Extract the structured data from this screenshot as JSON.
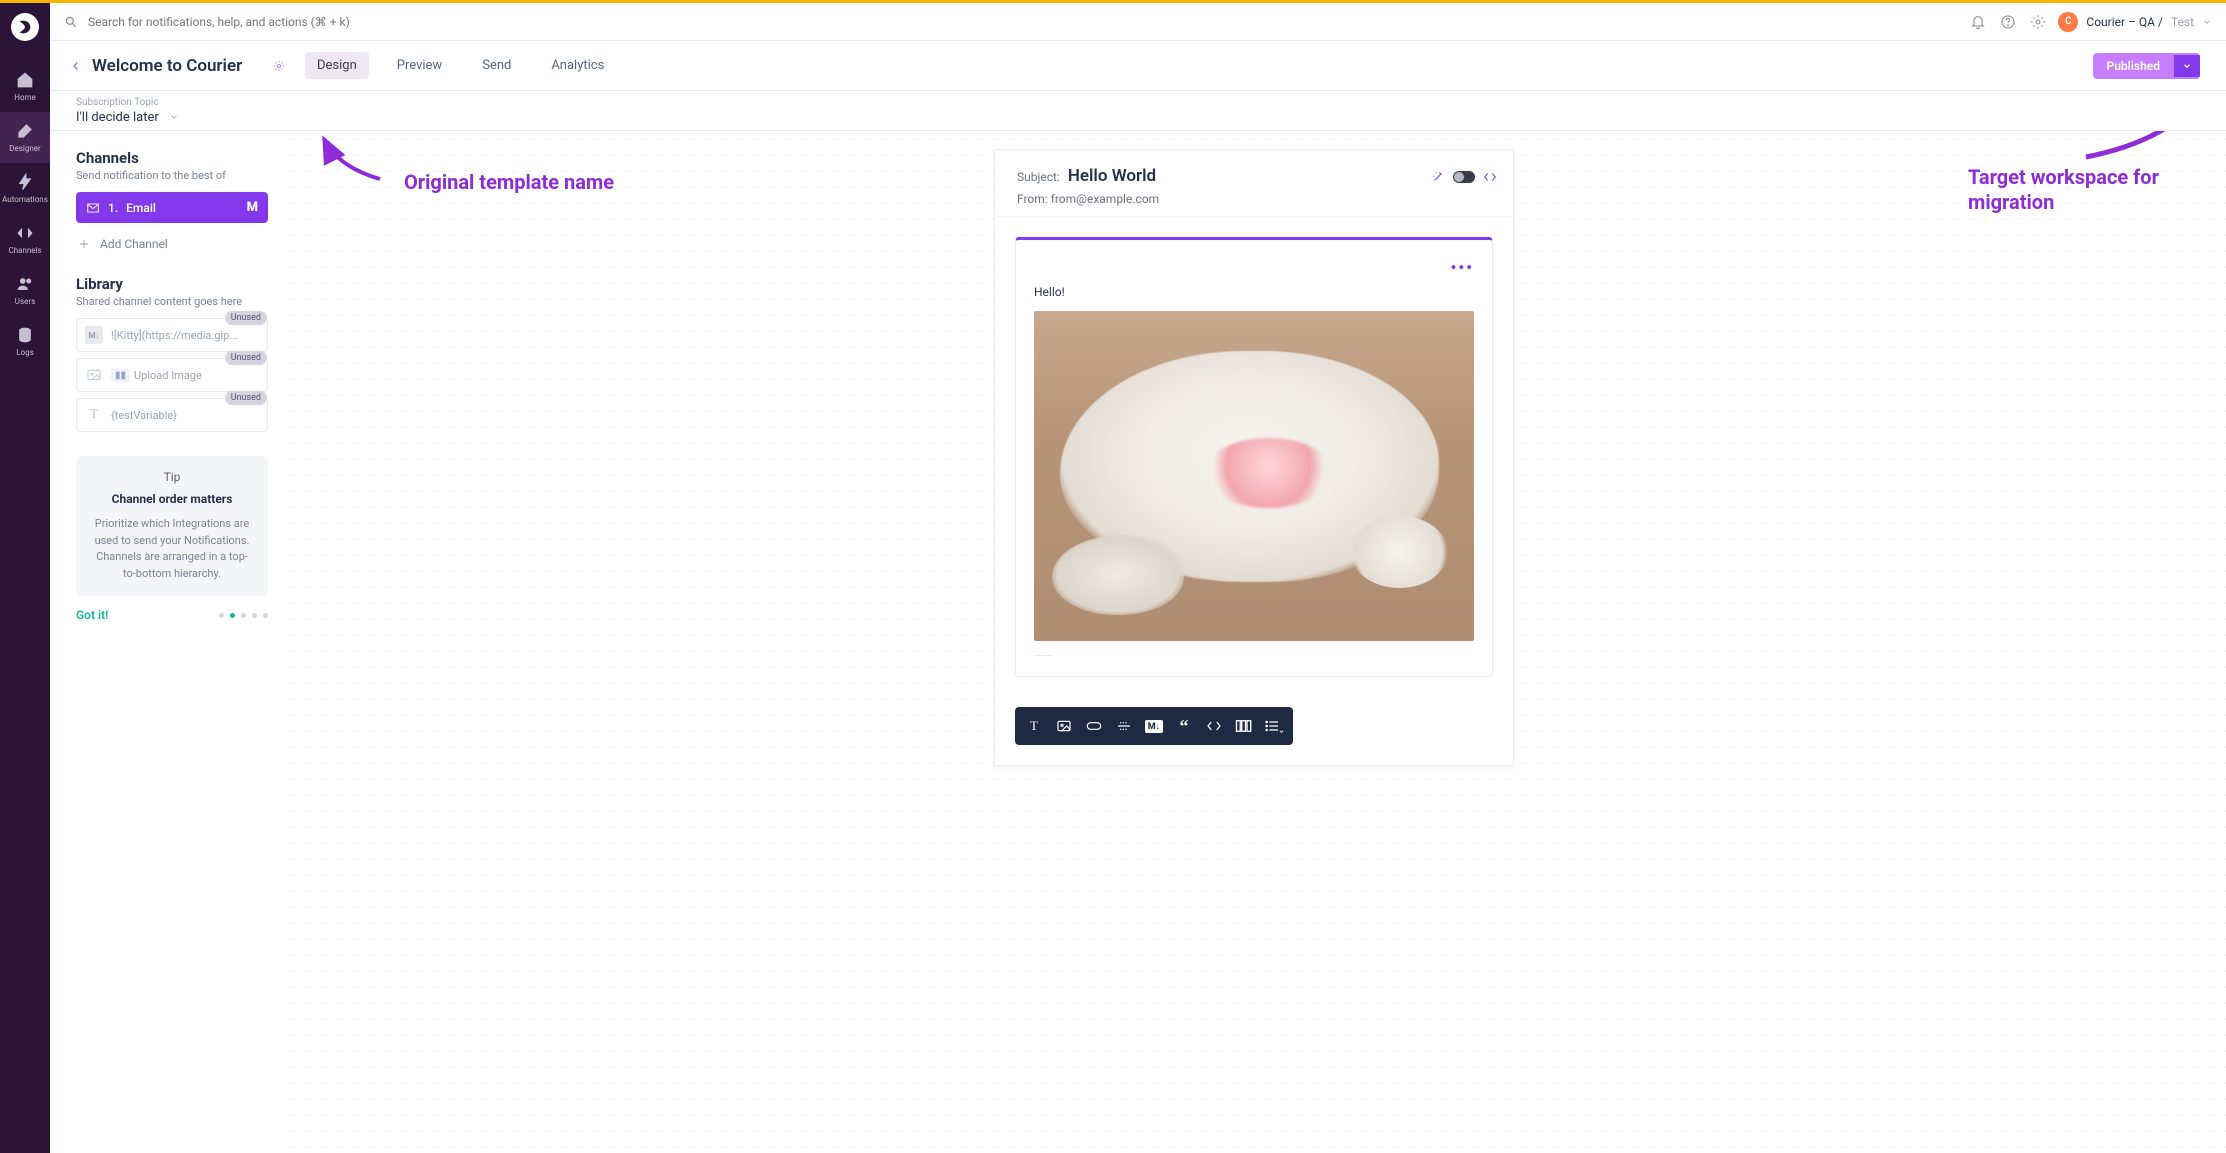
{
  "topbar": {
    "search_placeholder": "Search for notifications, help, and actions (⌘ + k)",
    "workspace_avatar": "C",
    "workspace_main": "Courier – QA /",
    "workspace_sub": "Test"
  },
  "nav": {
    "items": [
      "Home",
      "Designer",
      "Automations",
      "Channels",
      "Users",
      "Logs"
    ],
    "active_index": 1
  },
  "header": {
    "title": "Welcome to Courier",
    "tabs": [
      "Design",
      "Preview",
      "Send",
      "Analytics"
    ],
    "active_tab": 0,
    "publish_label": "Published"
  },
  "subscription": {
    "label": "Subscription Topic",
    "value": "I'll decide later"
  },
  "channels": {
    "title": "Channels",
    "subtitle": "Send notification to the best of",
    "item_number": "1.",
    "item_label": "Email",
    "add_label": "Add Channel"
  },
  "library": {
    "title": "Library",
    "subtitle": "Shared channel content goes here",
    "badge": "Unused",
    "items": [
      {
        "text": "![Kitty](https://media.gip...",
        "placeholder": ""
      },
      {
        "text": "Upload Image",
        "placeholder": "sel"
      },
      {
        "text": "{testVariable}",
        "placeholder": ""
      }
    ]
  },
  "tip": {
    "label": "Tip",
    "title": "Channel order matters",
    "body": "Prioritize which Integrations are used to send your Notifications. Channels are arranged in a top-to-bottom hierarchy.",
    "gotit": "Got it!"
  },
  "email": {
    "subject_label": "Subject:",
    "subject_value": "Hello World",
    "from_label": "From:",
    "from_value": "from@example.com",
    "hello": "Hello!",
    "toolbar_md": "M↓"
  },
  "annotations": {
    "a1": "Original template name",
    "a2": "Target workspace for migration"
  }
}
